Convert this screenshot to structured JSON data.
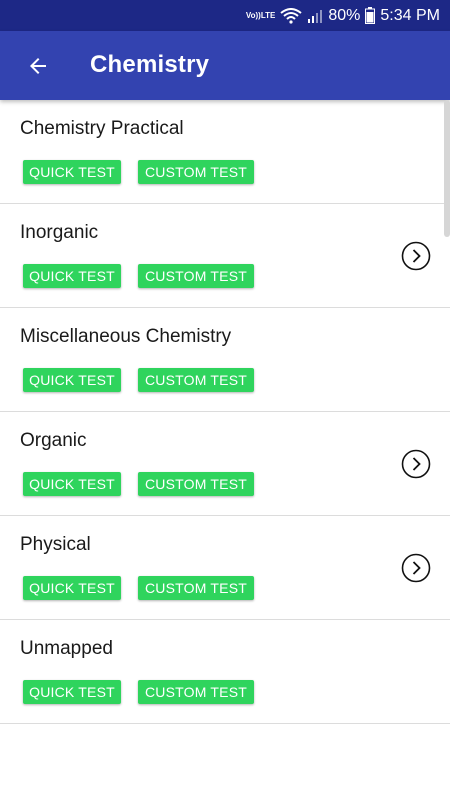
{
  "status_bar": {
    "volte_top": "Vo))",
    "volte_bottom": "LTE",
    "battery": "80%",
    "time": "5:34 PM"
  },
  "app_bar": {
    "title": "Chemistry",
    "back_icon": "arrow-left-icon"
  },
  "topics": [
    {
      "title": "Chemistry Practical",
      "quick_label": "QUICK TEST",
      "custom_label": "CUSTOM TEST",
      "has_chevron": false
    },
    {
      "title": "Inorganic",
      "quick_label": "QUICK TEST",
      "custom_label": "CUSTOM TEST",
      "has_chevron": true
    },
    {
      "title": "Miscellaneous Chemistry",
      "quick_label": "QUICK TEST",
      "custom_label": "CUSTOM TEST",
      "has_chevron": false
    },
    {
      "title": "Organic",
      "quick_label": "QUICK TEST",
      "custom_label": "CUSTOM TEST",
      "has_chevron": true
    },
    {
      "title": "Physical",
      "quick_label": "QUICK TEST",
      "custom_label": "CUSTOM TEST",
      "has_chevron": true
    },
    {
      "title": "Unmapped",
      "quick_label": "QUICK TEST",
      "custom_label": "CUSTOM TEST",
      "has_chevron": false
    }
  ],
  "colors": {
    "status_bar": "#1d2886",
    "app_bar": "#3343b0",
    "button": "#2fd45d",
    "divider": "#dcdcdc"
  }
}
